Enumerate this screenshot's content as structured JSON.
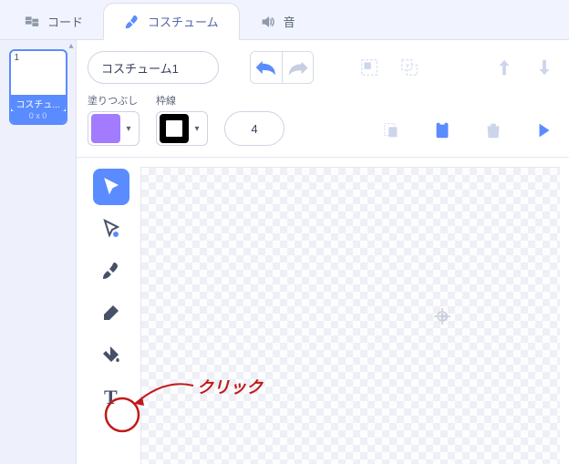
{
  "tabs": {
    "code": {
      "label": "コード"
    },
    "costume": {
      "label": "コスチューム"
    },
    "sound": {
      "label": "音"
    }
  },
  "costume_list": {
    "items": [
      {
        "index": "1",
        "name": "コスチュ...",
        "dims": "0 x 0"
      }
    ]
  },
  "editor": {
    "costume_name": "コスチューム1",
    "fill_label": "塗りつぶし",
    "outline_label": "枠線",
    "outline_width": "4",
    "colors": {
      "fill": "#a27bff",
      "outline": "#000000"
    }
  },
  "annotation": {
    "label": "クリック"
  }
}
